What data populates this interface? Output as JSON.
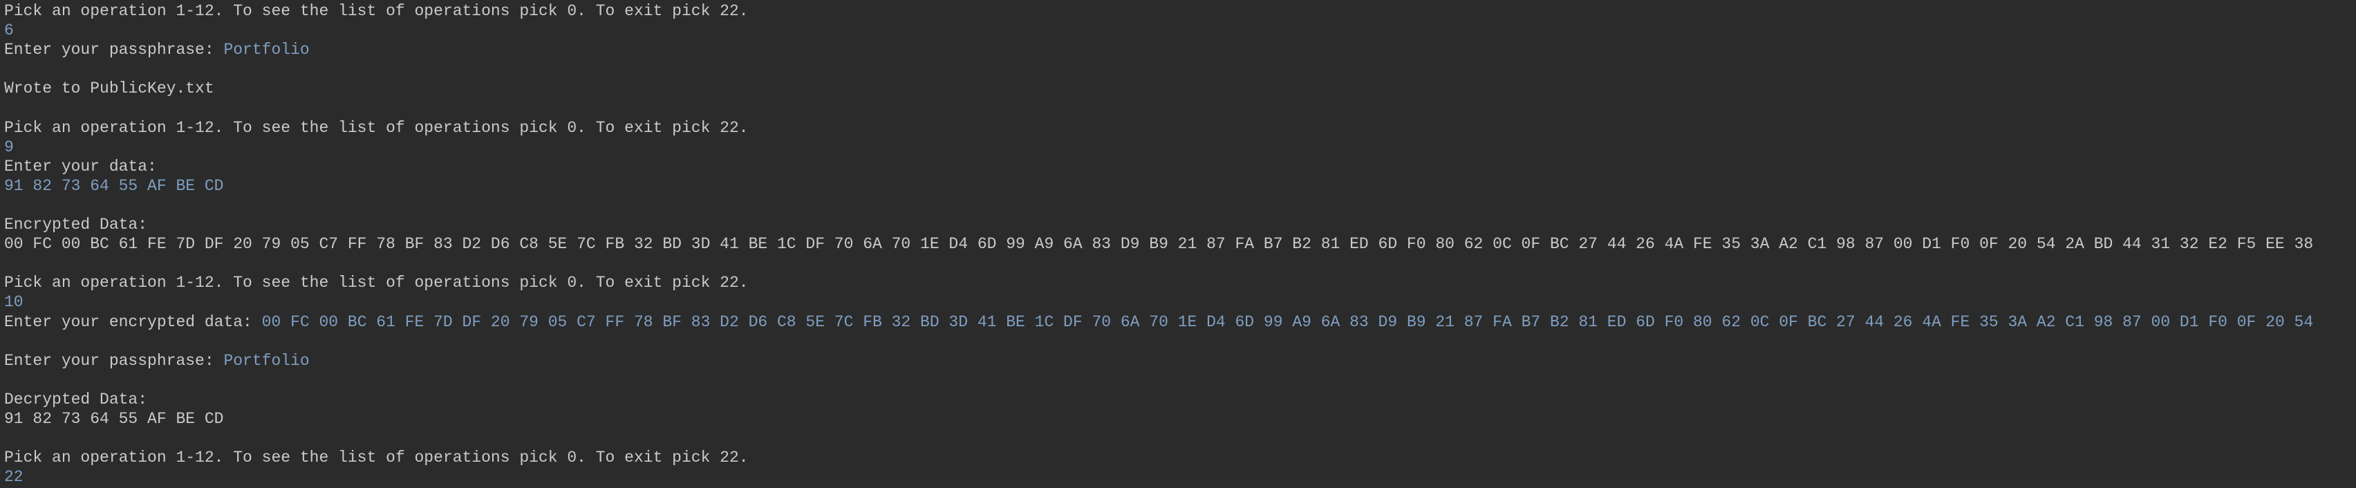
{
  "console": {
    "prompt_menu": "Pick an operation 1-12. To see the list of operations pick 0. To exit pick 22.",
    "choice_1": "6",
    "passphrase_prompt_1": "Enter your passphrase: ",
    "passphrase_input_1": "Portfolio",
    "wrote_message": "Wrote to PublicKey.txt",
    "prompt_menu_2": "Pick an operation 1-12. To see the list of operations pick 0. To exit pick 22.",
    "choice_2": "9",
    "data_prompt": "Enter your data:",
    "data_input": "91 82 73 64 55 AF BE CD",
    "encrypted_label": "Encrypted Data:",
    "encrypted_output": "00 FC 00 BC 61 FE 7D DF 20 79 05 C7 FF 78 BF 83 D2 D6 C8 5E 7C FB 32 BD 3D 41 BE 1C DF 70 6A 70 1E D4 6D 99 A9 6A 83 D9 B9 21 87 FA B7 B2 81 ED 6D F0 80 62 0C 0F BC 27 44 26 4A FE 35 3A A2 C1 98 87 00 D1 F0 0F 20 54 2A BD 44 31 32 E2 F5 EE 38",
    "prompt_menu_3": "Pick an operation 1-12. To see the list of operations pick 0. To exit pick 22.",
    "choice_3": "10",
    "encrypted_prompt": "Enter your encrypted data: ",
    "encrypted_input": "00 FC 00 BC 61 FE 7D DF 20 79 05 C7 FF 78 BF 83 D2 D6 C8 5E 7C FB 32 BD 3D 41 BE 1C DF 70 6A 70 1E D4 6D 99 A9 6A 83 D9 B9 21 87 FA B7 B2 81 ED 6D F0 80 62 0C 0F BC 27 44 26 4A FE 35 3A A2 C1 98 87 00 D1 F0 0F 20 54",
    "passphrase_prompt_2": "Enter your passphrase: ",
    "passphrase_input_2": "Portfolio",
    "decrypted_label": "Decrypted Data:",
    "decrypted_output": "91 82 73 64 55 AF BE CD",
    "prompt_menu_4": "Pick an operation 1-12. To see the list of operations pick 0. To exit pick 22.",
    "choice_4": "22"
  },
  "colors": {
    "background": "#2b2b2b",
    "output_text": "#cacaca",
    "user_input_text": "#7f9fc2"
  }
}
